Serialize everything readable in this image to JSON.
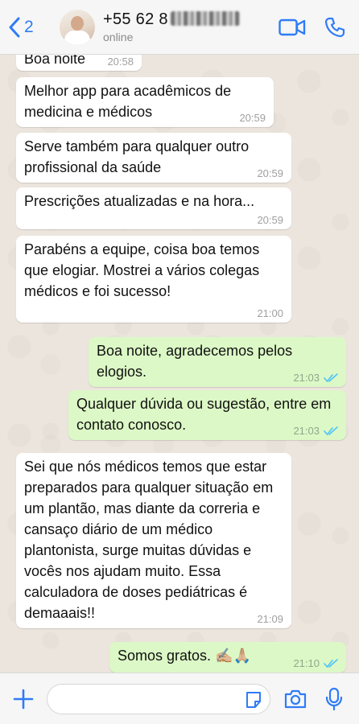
{
  "header": {
    "back_count": "2",
    "contact_name": "+55 62 8",
    "status": "online"
  },
  "messages": [
    {
      "text": "Boa noite",
      "time": "20:58",
      "direction": "in"
    },
    {
      "text": "Melhor app para acadêmicos de medicina e médicos",
      "time": "20:59",
      "direction": "in"
    },
    {
      "text": "Serve também para qualquer outro profissional da saúde",
      "time": "20:59",
      "direction": "in"
    },
    {
      "text": "Prescrições atualizadas e na hora...",
      "time": "20:59",
      "direction": "in"
    },
    {
      "text": "Parabéns a equipe, coisa boa temos que elogiar. Mostrei a vários colegas médicos e foi sucesso!",
      "time": "21:00",
      "direction": "in"
    },
    {
      "text": "Boa noite, agradecemos pelos elogios.",
      "time": "21:03",
      "direction": "out",
      "read": true
    },
    {
      "text": "Qualquer dúvida ou sugestão, entre em contato conosco.",
      "time": "21:03",
      "direction": "out",
      "read": true
    },
    {
      "text": "Sei que nós médicos temos que estar preparados para qualquer situação em um plantão, mas diante da correria e cansaço diário de um médico plantonista, surge muitas dúvidas e vocês nos ajudam muito. Essa calculadora de doses pediátricas é demaaais!!",
      "time": "21:09",
      "direction": "in"
    },
    {
      "text": "Somos gratos. ✍🏼🙏🏼",
      "time": "21:10",
      "direction": "out",
      "read": true
    }
  ],
  "colors": {
    "accent": "#2f7cf6",
    "incoming_bubble": "#ffffff",
    "outgoing_bubble": "#dcf8c6",
    "read_ticks": "#4fc3f7",
    "chat_background": "#ece5dd"
  },
  "icons": {
    "back": "chevron-left-icon",
    "video": "video-camera-icon",
    "call": "phone-icon",
    "attach": "plus-icon",
    "sticker": "sticker-icon",
    "camera": "camera-icon",
    "mic": "microphone-icon"
  }
}
